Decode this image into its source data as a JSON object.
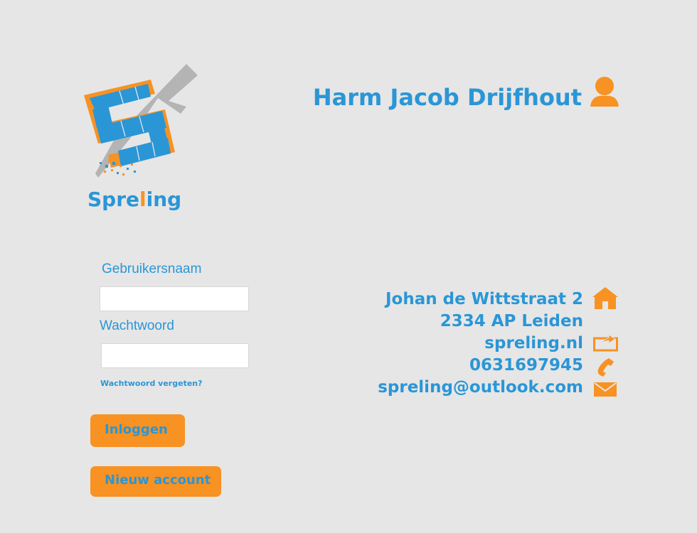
{
  "brand": {
    "name_prefix": "Spre",
    "name_accent": "l",
    "name_suffix": "ing",
    "colors": {
      "blue": "#2a96d6",
      "orange": "#f79223",
      "gray": "#b4b4b4",
      "background": "#e6e6e6"
    }
  },
  "header": {
    "user_name": "Harm Jacob Drijfhout",
    "user_icon": "user-icon"
  },
  "login": {
    "username_label": "Gebruikersnaam",
    "username_value": "",
    "password_label": "Wachtwoord",
    "password_value": "",
    "forgot_label": "Wachtwoord vergeten?",
    "login_button": "Inloggen",
    "new_account_button": "Nieuw account"
  },
  "contact": {
    "street": "Johan de Wittstraat 2",
    "city": "2334 AP Leiden",
    "website": "spreling.nl",
    "phone": "0631697945",
    "email": "spreling@outlook.com",
    "icons": [
      "home-icon",
      "website-icon",
      "phone-icon",
      "mail-icon"
    ]
  }
}
